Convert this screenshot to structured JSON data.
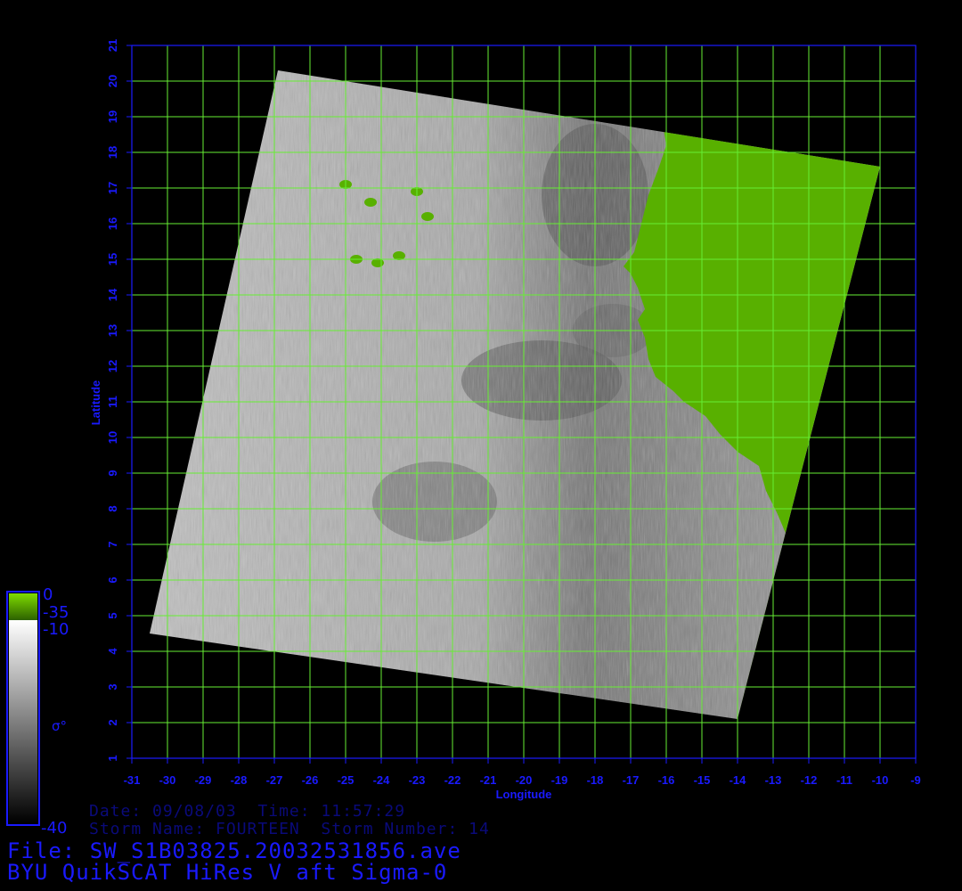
{
  "plot": {
    "x_label": "Longitude",
    "y_label": "Latitude",
    "x_range": [
      -31,
      -9
    ],
    "y_range": [
      1,
      21
    ],
    "x_ticks": [
      "-31",
      "-30",
      "-29",
      "-28",
      "-27",
      "-26",
      "-25",
      "-24",
      "-23",
      "-22",
      "-21",
      "-20",
      "-19",
      "-18",
      "-17",
      "-16",
      "-15",
      "-14",
      "-13",
      "-12",
      "-11",
      "-10",
      "-9"
    ],
    "y_ticks": [
      "1",
      "2",
      "3",
      "4",
      "5",
      "6",
      "7",
      "8",
      "9",
      "10",
      "11",
      "12",
      "13",
      "14",
      "15",
      "16",
      "17",
      "18",
      "19",
      "20",
      "21"
    ],
    "grid": true,
    "colors": {
      "axis": "#1a1aff",
      "grid": "#66ee33",
      "land": "#58b000",
      "ocean_light": "#c8c8c8",
      "ocean_dark": "#505050"
    },
    "swath_corners_lonlat": [
      [
        -26.9,
        20.3
      ],
      [
        -10.0,
        17.6
      ],
      [
        -14.0,
        2.1
      ],
      [
        -30.5,
        4.5
      ]
    ],
    "coast_lonlat": [
      [
        -16.1,
        18.8
      ],
      [
        -16.0,
        18.2
      ],
      [
        -16.2,
        17.6
      ],
      [
        -16.5,
        16.8
      ],
      [
        -16.7,
        16.0
      ],
      [
        -16.9,
        15.2
      ],
      [
        -17.2,
        14.8
      ],
      [
        -17.0,
        14.6
      ],
      [
        -16.8,
        14.2
      ],
      [
        -16.6,
        13.6
      ],
      [
        -16.8,
        13.3
      ],
      [
        -16.6,
        12.8
      ],
      [
        -16.5,
        12.2
      ],
      [
        -16.3,
        11.7
      ],
      [
        -15.8,
        11.3
      ],
      [
        -15.5,
        11.0
      ],
      [
        -14.9,
        10.6
      ],
      [
        -14.5,
        10.1
      ],
      [
        -14.0,
        9.6
      ],
      [
        -13.4,
        9.2
      ],
      [
        -13.2,
        8.5
      ],
      [
        -12.9,
        7.9
      ],
      [
        -12.6,
        7.2
      ]
    ],
    "islands_lonlat": [
      [
        -25.0,
        17.1
      ],
      [
        -24.3,
        16.6
      ],
      [
        -23.0,
        16.9
      ],
      [
        -22.7,
        16.2
      ],
      [
        -24.7,
        15.0
      ],
      [
        -24.1,
        14.9
      ],
      [
        -23.5,
        15.1
      ]
    ]
  },
  "colorbar": {
    "top_label": "0",
    "label_2": "-35",
    "label_3": "-10",
    "bottom_label": "-40",
    "symbol": "σ°"
  },
  "info": {
    "line1": "Date: 09/08/03  Time: 11:57:29",
    "line2": "Storm Name: FOURTEEN  Storm Number: 14",
    "file_line": "File: SW_S1B03825.20032531856.ave",
    "product_line": "BYU QuikSCAT HiRes V aft Sigma-0"
  }
}
